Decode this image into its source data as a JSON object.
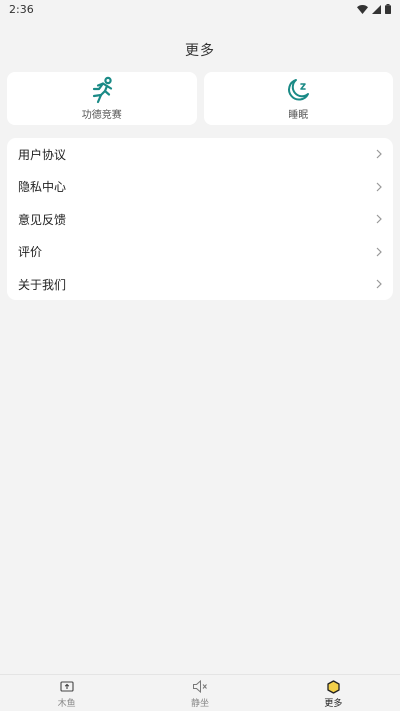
{
  "status_bar": {
    "time": "2:36",
    "icons": [
      "wifi-icon",
      "signal-icon",
      "battery-icon"
    ]
  },
  "header": {
    "title": "更多"
  },
  "feature_cards": [
    {
      "label": "功德竞赛",
      "icon": "running-person-icon",
      "accent": "#1a8a86"
    },
    {
      "label": "睡眠",
      "icon": "moon-sleep-icon",
      "accent": "#1a8a86"
    }
  ],
  "menu": {
    "items": [
      {
        "label": "用户协议"
      },
      {
        "label": "隐私中心"
      },
      {
        "label": "意见反馈"
      },
      {
        "label": "评价"
      },
      {
        "label": "关于我们"
      }
    ]
  },
  "bottom_nav": {
    "items": [
      {
        "label": "木鱼",
        "icon": "wooden-fish-icon",
        "active": false
      },
      {
        "label": "静坐",
        "icon": "speaker-mute-icon",
        "active": false
      },
      {
        "label": "更多",
        "icon": "hexagon-icon",
        "active": true
      }
    ]
  }
}
